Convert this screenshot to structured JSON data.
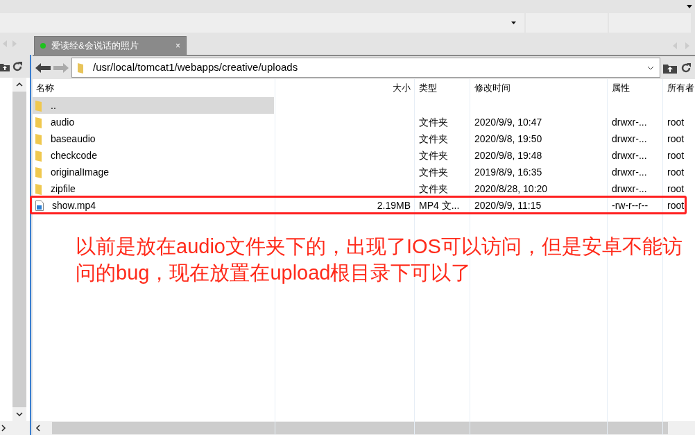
{
  "tab": {
    "label": "爱读经&会说话的照片",
    "connected": true,
    "close": "×"
  },
  "path": "/usr/local/tomcat1/webapps/creative/uploads",
  "columns": [
    "名称",
    "大小",
    "类型",
    "修改时间",
    "属性",
    "所有者"
  ],
  "rows": [
    {
      "kind": "folder",
      "name": "..",
      "selected": true
    },
    {
      "kind": "folder",
      "name": "audio",
      "size": "",
      "type": "文件夹",
      "modified": "2020/9/9, 10:47",
      "attributes": "drwxr-...",
      "owner": "root",
      "selected": false
    },
    {
      "kind": "folder",
      "name": "baseaudio",
      "size": "",
      "type": "文件夹",
      "modified": "2020/9/8, 19:50",
      "attributes": "drwxr-...",
      "owner": "root",
      "selected": false
    },
    {
      "kind": "folder",
      "name": "checkcode",
      "size": "",
      "type": "文件夹",
      "modified": "2020/9/8, 19:48",
      "attributes": "drwxr-...",
      "owner": "root",
      "selected": false
    },
    {
      "kind": "folder",
      "name": "originalImage",
      "size": "",
      "type": "文件夹",
      "modified": "2019/8/9, 16:35",
      "attributes": "drwxr-...",
      "owner": "root",
      "selected": false
    },
    {
      "kind": "folder",
      "name": "zipfile",
      "size": "",
      "type": "文件夹",
      "modified": "2020/8/28, 10:20",
      "attributes": "drwxr-...",
      "owner": "root",
      "selected": false
    },
    {
      "kind": "video",
      "name": "show.mp4",
      "size": "2.19MB",
      "type": "MP4 文...",
      "modified": "2020/9/9, 11:15",
      "attributes": "-rw-r--r--",
      "owner": "root",
      "selected": false
    }
  ],
  "annotation": "以前是放在audio文件夹下的，出现了IOS可以访问，但是安卓不能访问的bug，现在放置在upload根目录下可以了"
}
